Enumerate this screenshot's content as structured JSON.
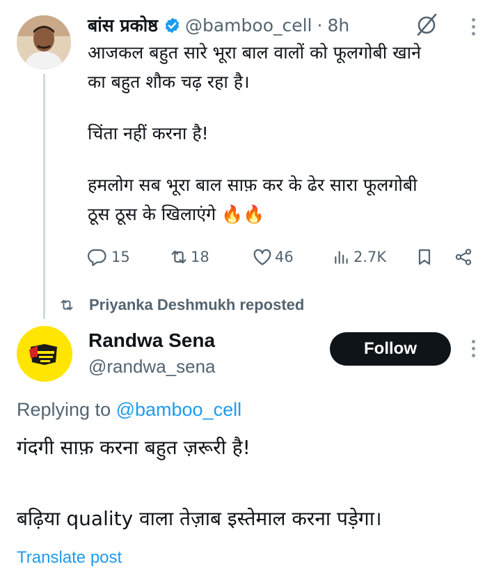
{
  "tweet1": {
    "author_name": "बांस प्रकोष्ठ",
    "handle": "@bamboo_cell",
    "separator": "·",
    "time": "8h",
    "lines": [
      "आजकल बहुत सारे भूरा बाल वालों को फूलगोबी खाने",
      "का बहुत शौक चढ़ रहा है।",
      "चिंता नहीं करना है!",
      "हमलोग सब भूरा बाल साफ़ कर के ढेर सारा फूलगोबी",
      "ठूस ठूस के खिलाएंगे 🔥🔥"
    ],
    "stats": {
      "replies": "15",
      "reposts": "18",
      "likes": "46",
      "views": "2.7K"
    }
  },
  "repost_banner": {
    "text": "Priyanka Deshmukh reposted"
  },
  "tweet2": {
    "author_name": "Randwa Sena",
    "handle": "@randwa_sena",
    "follow_label": "Follow",
    "replying_prefix": "Replying to ",
    "replying_handle": "@bamboo_cell",
    "lines": [
      "गंदगी साफ़ करना बहुत ज़रूरी है!",
      "बढ़िया quality वाला तेज़ाब इस्तेमाल करना पड़ेगा।"
    ],
    "translate_label": "Translate post",
    "avatar_text": "THE RANDWA INDIAN"
  },
  "colors": {
    "text": "#0f1419",
    "muted": "#536471",
    "link": "#1d9bf0",
    "verified": "#1d9bf0",
    "avatar_yellow": "#ffe500"
  },
  "icons": {
    "verified": "verified-badge-icon",
    "grok": "grok-icon",
    "more": "more-vertical-icon",
    "reply": "reply-icon",
    "repost": "repost-icon",
    "like": "heart-icon",
    "views": "views-icon",
    "bookmark": "bookmark-icon",
    "share": "share-icon"
  }
}
